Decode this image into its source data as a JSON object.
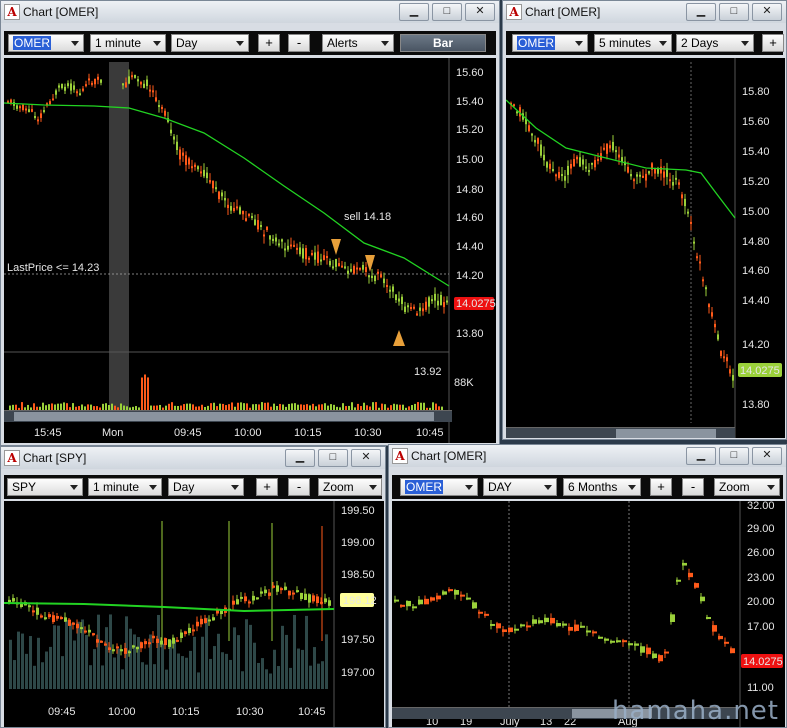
{
  "windows": {
    "w1": {
      "title": "Chart [OMER]",
      "symbol": "OMER",
      "interval": "1 minute",
      "range": "Day",
      "plus": "+",
      "minus": "-",
      "alerts": "Alerts",
      "style": "Bar",
      "price_labels": [
        "15.60",
        "15.40",
        "15.20",
        "15.00",
        "14.80",
        "14.60",
        "14.40",
        "14.20",
        "13.80"
      ],
      "volume_label": "88K",
      "last_price_tag": "14.0275",
      "lastprice_line": "LastPrice <= 14.23",
      "annotation_sell": "sell 14.18",
      "annotation_low": "13.92",
      "time_labels": [
        "15:45",
        "Mon",
        "09:45",
        "10:00",
        "10:15",
        "10:30",
        "10:45"
      ]
    },
    "w2": {
      "title": "Chart [OMER]",
      "symbol": "OMER",
      "interval": "5 minutes",
      "range": "2 Days",
      "plus": "+",
      "price_labels": [
        "15.80",
        "15.60",
        "15.40",
        "15.20",
        "15.00",
        "14.80",
        "14.60",
        "14.40",
        "14.20",
        "13.80"
      ],
      "last_price_tag": "14.0275"
    },
    "w3": {
      "title": "Chart [SPY]",
      "symbol": "SPY",
      "interval": "1 minute",
      "range": "Day",
      "plus": "+",
      "minus": "-",
      "zoom": "Zoom",
      "price_labels": [
        "199.50",
        "199.00",
        "198.50",
        "197.50",
        "197.00"
      ],
      "last_price_tag": "198.12",
      "time_labels": [
        "09:45",
        "10:00",
        "10:15",
        "10:30",
        "10:45"
      ]
    },
    "w4": {
      "title": "Chart [OMER]",
      "symbol": "OMER",
      "interval": "DAY",
      "range": "6 Months",
      "plus": "+",
      "minus": "-",
      "zoom": "Zoom",
      "price_labels": [
        "32.00",
        "29.00",
        "26.00",
        "23.00",
        "20.00",
        "17.00",
        "11.00"
      ],
      "last_price_tag": "14.0275",
      "time_labels": [
        "10",
        "19",
        "July",
        "13",
        "22",
        "Aug"
      ]
    }
  },
  "watermark": "hamaha.net",
  "colors": {
    "up": "#9bd13a",
    "down": "#ff5a1a",
    "ma": "#22d322",
    "tag": "#e11",
    "annot": "#e8a03a"
  }
}
